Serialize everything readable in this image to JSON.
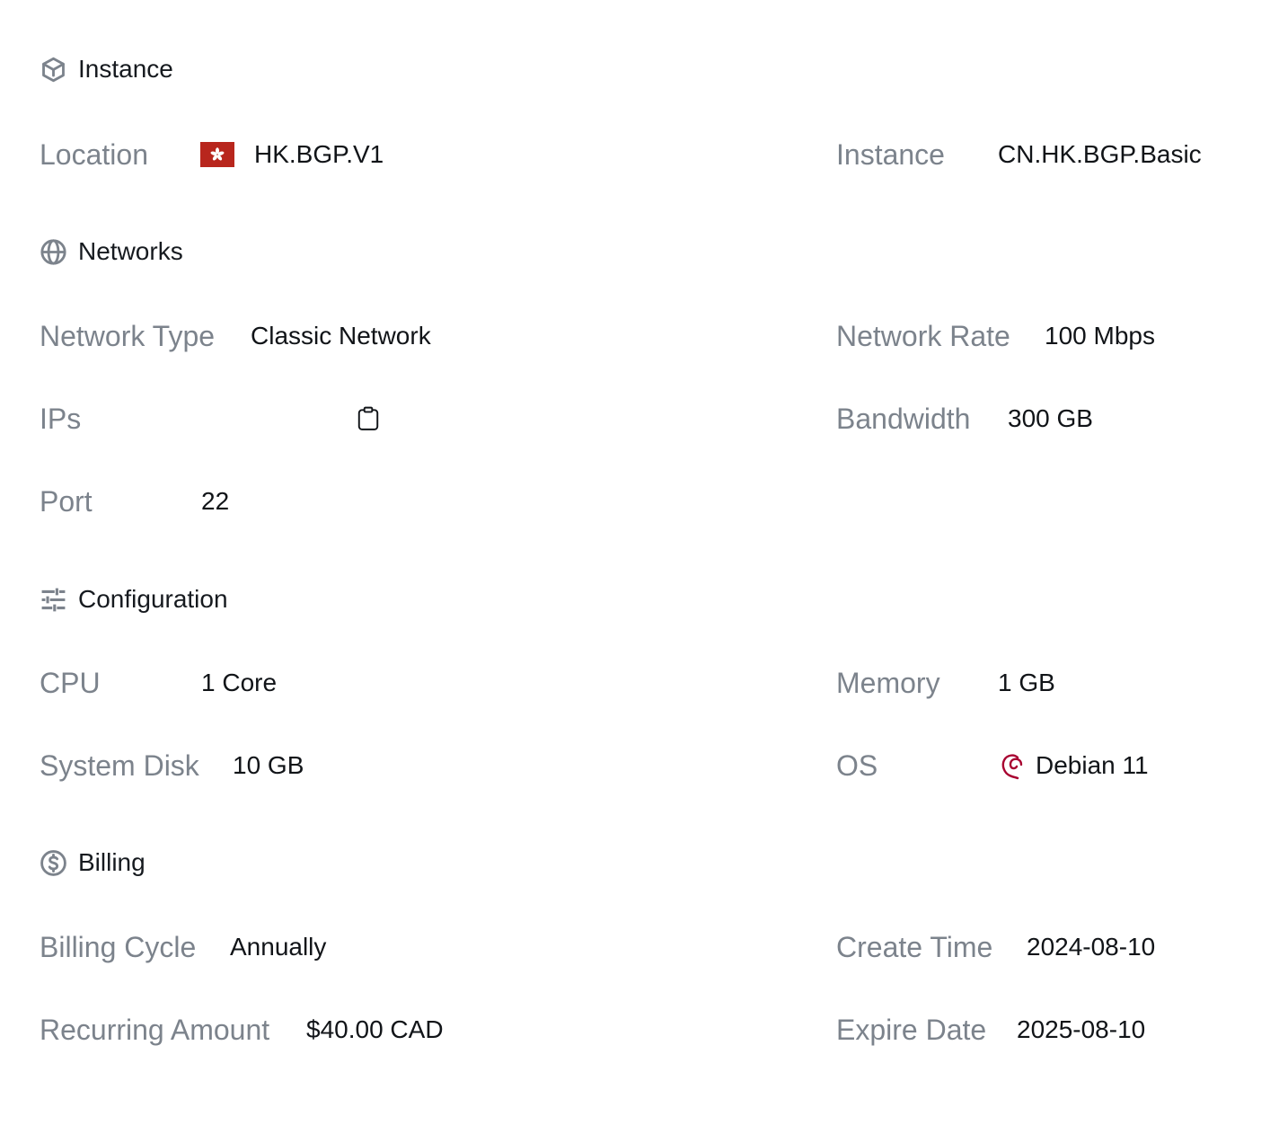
{
  "sections": {
    "instance": {
      "title": "Instance",
      "location_label": "Location",
      "location_value": "HK.BGP.V1",
      "instance_label": "Instance",
      "instance_value": "CN.HK.BGP.Basic"
    },
    "networks": {
      "title": "Networks",
      "network_type_label": "Network Type",
      "network_type_value": "Classic Network",
      "network_rate_label": "Network Rate",
      "network_rate_value": "100 Mbps",
      "ips_label": "IPs",
      "ips_value": "",
      "bandwidth_label": "Bandwidth",
      "bandwidth_value": "300 GB",
      "port_label": "Port",
      "port_value": "22"
    },
    "configuration": {
      "title": "Configuration",
      "cpu_label": "CPU",
      "cpu_value": "1 Core",
      "memory_label": "Memory",
      "memory_value": "1 GB",
      "system_disk_label": "System Disk",
      "system_disk_value": "10 GB",
      "os_label": "OS",
      "os_value": "Debian 11"
    },
    "billing": {
      "title": "Billing",
      "billing_cycle_label": "Billing Cycle",
      "billing_cycle_value": "Annually",
      "create_time_label": "Create Time",
      "create_time_value": "2024-08-10",
      "recurring_amount_label": "Recurring Amount",
      "recurring_amount_value": "$40.00 CAD",
      "expire_date_label": "Expire Date",
      "expire_date_value": "2025-08-10"
    }
  },
  "icons": {
    "instance": "cube-icon",
    "networks": "globe-icon",
    "configuration": "sliders-icon",
    "billing": "dollar-coin-icon",
    "location_flag": "hong-kong-flag-icon",
    "copy": "clipboard-icon",
    "os": "debian-logo-icon"
  },
  "colors": {
    "label": "#7c838c",
    "value": "#111418",
    "icon": "#7c838c",
    "flag_red": "#b8261d",
    "debian_red": "#a80030"
  }
}
